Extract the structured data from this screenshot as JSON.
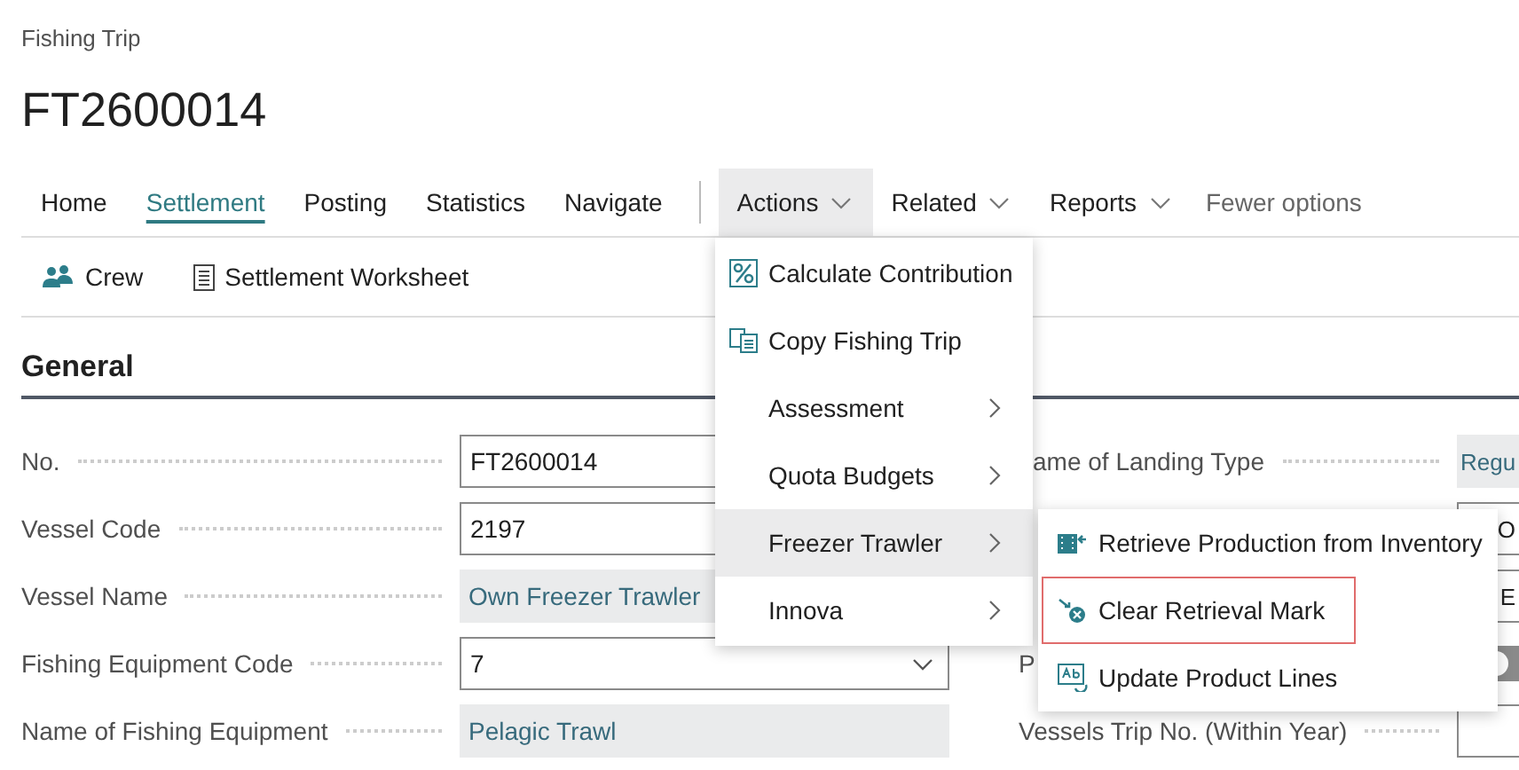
{
  "page": {
    "caption": "Fishing Trip",
    "title": "FT2600014"
  },
  "nav": {
    "tabs": [
      {
        "label": "Home",
        "selected": false
      },
      {
        "label": "Settlement",
        "selected": true
      },
      {
        "label": "Posting",
        "selected": false
      },
      {
        "label": "Statistics",
        "selected": false
      },
      {
        "label": "Navigate",
        "selected": false
      }
    ],
    "menus": [
      {
        "label": "Actions",
        "expanded": true
      },
      {
        "label": "Related",
        "expanded": false
      },
      {
        "label": "Reports",
        "expanded": false
      }
    ],
    "fewer_options": "Fewer options"
  },
  "actions": [
    {
      "label": "Crew"
    },
    {
      "label": "Settlement Worksheet"
    }
  ],
  "section": {
    "title": "General"
  },
  "fields_left": [
    {
      "label": "No.",
      "value": "FT2600014",
      "kind": "input"
    },
    {
      "label": "Vessel Code",
      "value": "2197",
      "kind": "input"
    },
    {
      "label": "Vessel Name",
      "value": "Own Freezer Trawler",
      "kind": "readonly"
    },
    {
      "label": "Fishing Equipment Code",
      "value": "7",
      "kind": "dropdown"
    },
    {
      "label": "Name of Fishing Equipment",
      "value": "Pelagic Trawl",
      "kind": "readonly"
    }
  ],
  "fields_right": [
    {
      "label": "ame of Landing Type",
      "value": "Regu",
      "kind": "readonly"
    },
    {
      "value": "O",
      "kind": "input"
    },
    {
      "value": "E",
      "kind": "input"
    },
    {
      "label": "P",
      "kind": "toggle",
      "on": false
    },
    {
      "label": "Vessels Trip No. (Within Year)",
      "kind": "input"
    }
  ],
  "actions_menu": [
    {
      "label": "Calculate Contribution",
      "submenu": false,
      "selected": false
    },
    {
      "label": "Copy Fishing Trip",
      "submenu": false,
      "selected": false
    },
    {
      "label": "Assessment",
      "submenu": true,
      "selected": false
    },
    {
      "label": "Quota Budgets",
      "submenu": true,
      "selected": false
    },
    {
      "label": "Freezer Trawler",
      "submenu": true,
      "selected": true
    },
    {
      "label": "Innova",
      "submenu": true,
      "selected": false
    }
  ],
  "submenu": [
    {
      "label": "Retrieve Production from Inventory",
      "highlighted": false
    },
    {
      "label": "Clear Retrieval Mark",
      "highlighted": true
    },
    {
      "label": "Update Product Lines",
      "highlighted": false
    }
  ]
}
